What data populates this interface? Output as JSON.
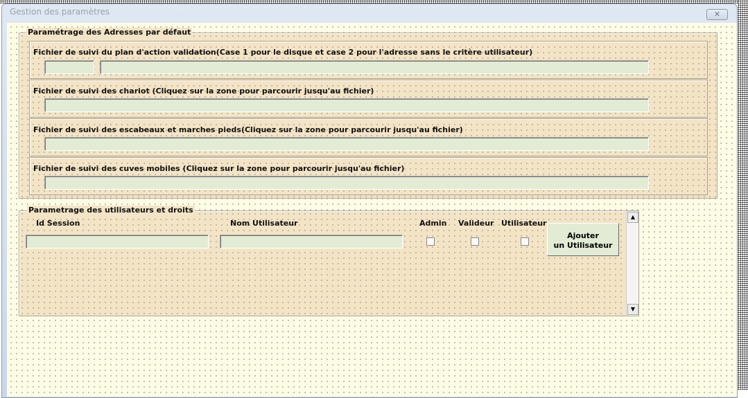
{
  "window": {
    "title": "Gestion des paramètres",
    "close_label": "✕"
  },
  "frame_addresses": {
    "legend": "Paramétrage des Adresses par défaut",
    "sections": [
      {
        "label": "Fichier de suivi du plan d'action validation(Case 1 pour le disque et case 2 pour l'adresse sans le critère utilisateur)"
      },
      {
        "label": "Fichier de suivi des chariot (Cliquez sur la zone pour parcourir jusqu'au fichier)"
      },
      {
        "label": "Fichier de suivi des escabeaux et marches pieds(Cliquez sur la zone pour parcourir jusqu'au fichier)"
      },
      {
        "label": "Fichier de suivi des cuves mobiles (Cliquez sur la zone pour parcourir jusqu'au fichier)"
      }
    ]
  },
  "frame_users": {
    "legend": "Parametrage des utilisateurs et droits",
    "col_id_session": "Id Session",
    "col_nom": "Nom Utilisateur",
    "col_admin": "Admin",
    "col_valideur": "Valideur",
    "col_utilisateur": "Utilisateur",
    "add_button_line1": "Ajouter",
    "add_button_line2": "un Utilisateur",
    "scroll_up": "▲",
    "scroll_down": "▼"
  }
}
